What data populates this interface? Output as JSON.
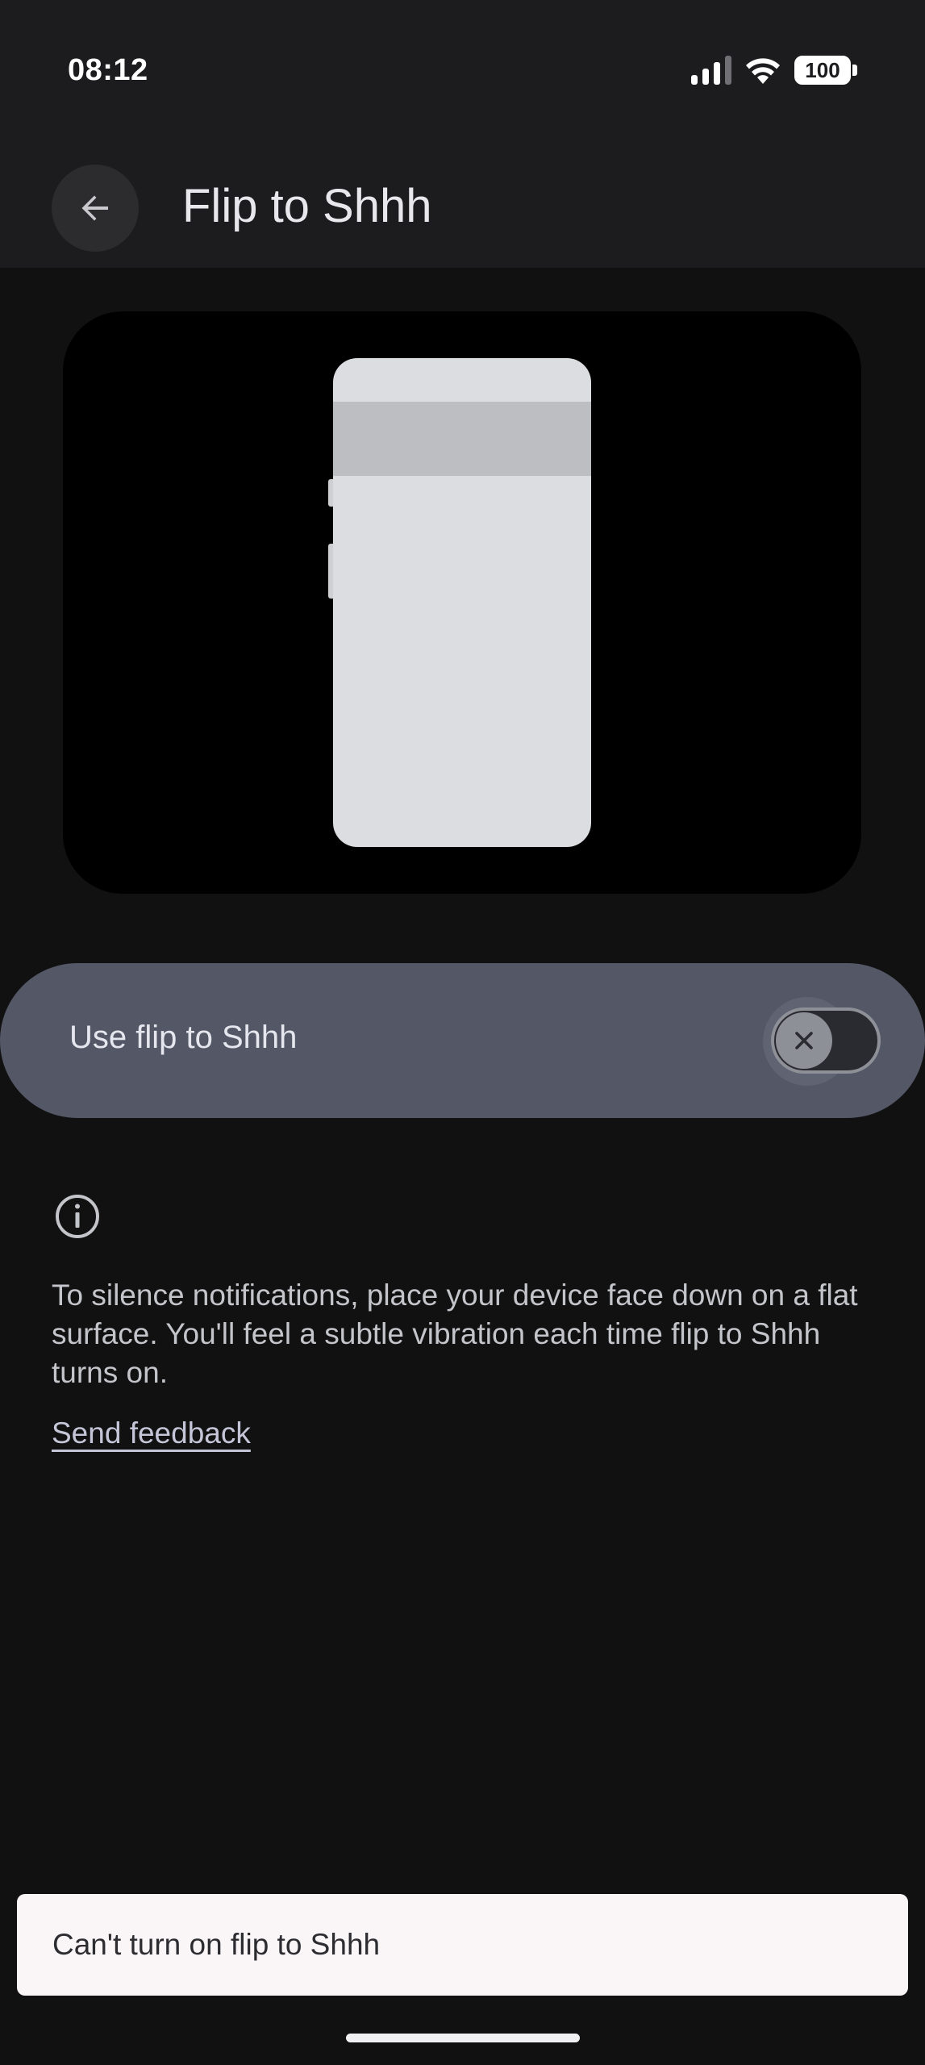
{
  "status_bar": {
    "time": "08:12",
    "battery": "100",
    "signal_icon": "cellular-signal-icon",
    "wifi_icon": "wifi-icon"
  },
  "app_bar": {
    "title": "Flip to Shhh",
    "back_icon": "arrow-left-icon"
  },
  "toggle": {
    "label": "Use flip to Shhh",
    "state": "off",
    "thumb_icon": "close-icon"
  },
  "info": {
    "icon": "info-icon",
    "description": "To silence notifications, place your device face down on a flat surface. You'll feel a subtle vibration each time flip to Shhh turns on.",
    "feedback_link": "Send feedback"
  },
  "snackbar": {
    "message": "Can't turn on flip to Shhh"
  },
  "colors": {
    "background": "#111112",
    "app_bar": "#1c1c1e",
    "toggle_row": "#535766",
    "snackbar": "#faf6f7"
  }
}
